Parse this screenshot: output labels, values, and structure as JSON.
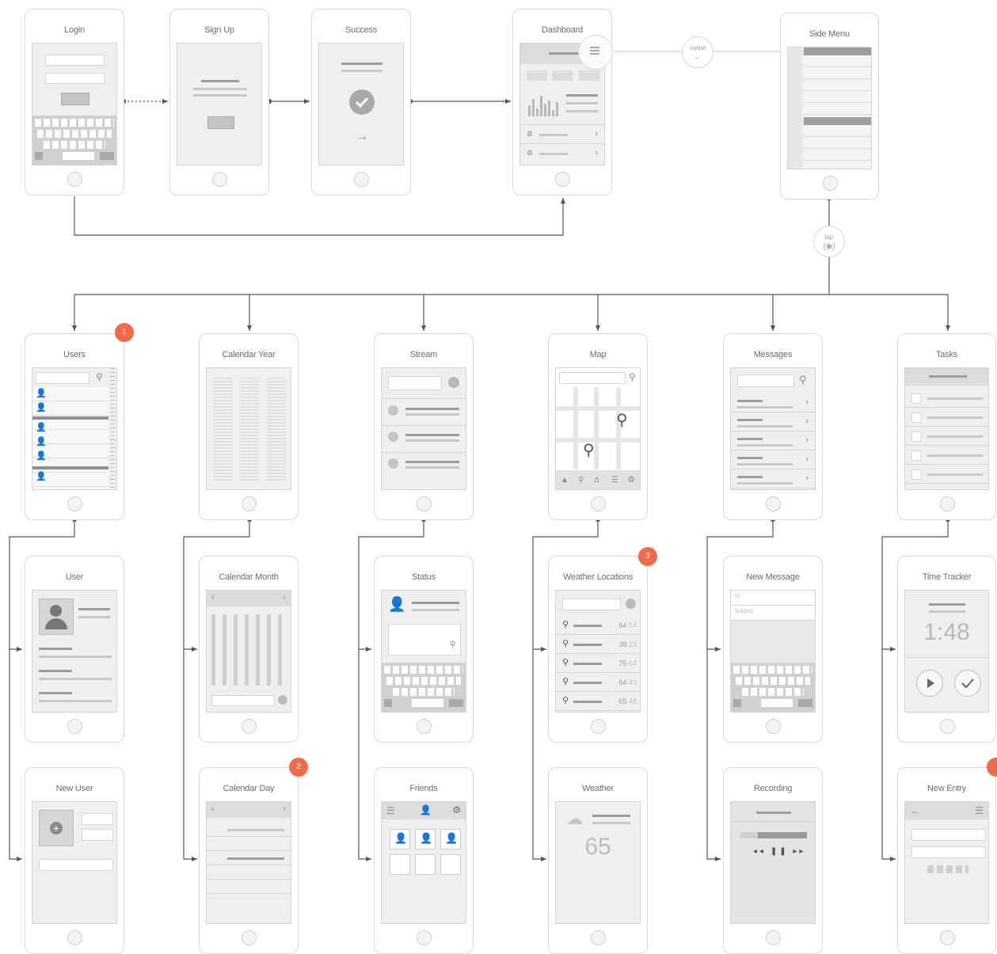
{
  "screens": {
    "login": "Login",
    "signup": "Sign Up",
    "success": "Success",
    "dashboard": "Dashboard",
    "side_menu": "Side Menu",
    "users": "Users",
    "calendar_year": "Calendar Year",
    "stream": "Stream",
    "map": "Map",
    "messages": "Messages",
    "tasks": "Tasks",
    "user": "User",
    "calendar_month": "Calendar Month",
    "status": "Status",
    "weather_locations": "Weather Locations",
    "new_message": "New Message",
    "time_tracker": "Time Tracker",
    "new_user": "New User",
    "calendar_day": "Calendar Day",
    "friends": "Friends",
    "weather": "Weather",
    "recording": "Recording",
    "new_entry": "New Entry"
  },
  "gestures": {
    "swipe_label": "swipe",
    "swipe_symbol": "←",
    "tap_label": "tap",
    "tap_symbol": "(◉)"
  },
  "badges": {
    "users": "1",
    "calendar_day": "2",
    "weather_locations": "3"
  },
  "weather_locations": {
    "rows": [
      {
        "high": "64",
        "low": "54"
      },
      {
        "high": "38",
        "low": "23"
      },
      {
        "high": "75",
        "low": "64"
      },
      {
        "high": "64",
        "low": "49"
      },
      {
        "high": "65",
        "low": "48"
      }
    ]
  },
  "time_tracker": {
    "time": "1:48"
  },
  "weather": {
    "temperature": "65"
  },
  "new_message": {
    "to_label": "To:",
    "subject_label": "Subject:"
  },
  "colors": {
    "badge": "#f26b48",
    "connector": "#555555",
    "phone_border": "#d9d9d9",
    "screen_bg": "#efefef"
  },
  "icons": {
    "search": "search-icon",
    "checkmark": "checkmark-icon",
    "arrow": "arrow-right-icon",
    "hamburger": "hamburger-icon",
    "pin": "map-pin-icon",
    "person": "person-icon",
    "cloud": "cloud-icon",
    "play": "play-icon",
    "media_controls": "media-controls-icon"
  }
}
